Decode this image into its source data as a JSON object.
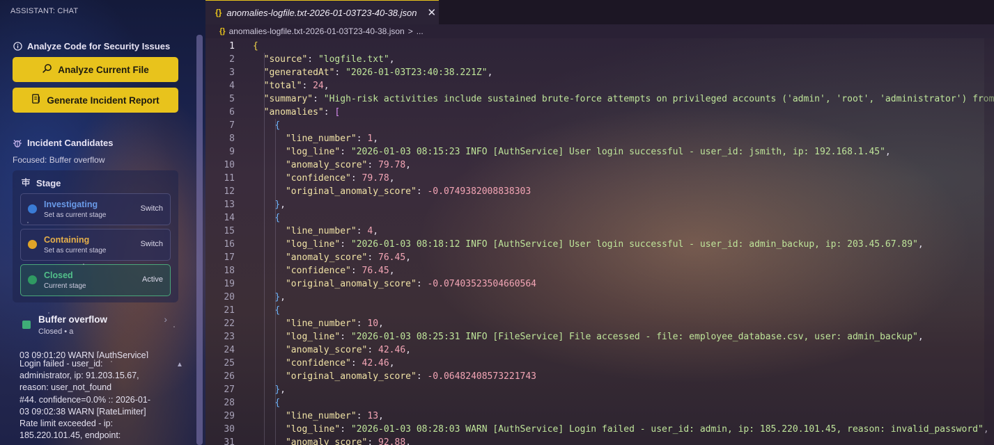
{
  "sidebar": {
    "title": "ASSISTANT: CHAT",
    "analyze_section": "Analyze Code for Security Issues",
    "analyze_button": "Analyze Current File",
    "report_button": "Generate Incident Report",
    "incident_section": "Incident Candidates",
    "focused": "Focused: Buffer overflow",
    "stage": {
      "title": "Stage",
      "cards": [
        {
          "name": "Investigating",
          "sub": "Set as current stage",
          "action": "Switch",
          "color": "#3a7bd5"
        },
        {
          "name": "Containing",
          "sub": "Set as current stage",
          "action": "Switch",
          "color": "#e0a428"
        },
        {
          "name": "Closed",
          "sub": "Current stage",
          "action": "Active",
          "color": "#2f9a62"
        }
      ]
    },
    "incident": {
      "name": "Buffer overflow",
      "meta": "Closed • a"
    },
    "log_partial": "03 09:01:20 WARN [AuthService]",
    "log_text": "Login failed - user_id:\nadministrator, ip: 91.203.15.67,\nreason: user_not_found\n#44. confidence=0.0% :: 2026-01-\n03 09:02:38 WARN [RateLimiter]\nRate limit exceeded - ip:\n185.220.101.45, endpoint:"
  },
  "editor": {
    "tab_icon": "{}",
    "tab_label": "anomalies-logfile.txt-2026-01-03T23-40-38.json",
    "close_glyph": "✕",
    "breadcrumb_file": "anomalies-logfile.txt-2026-01-03T23-40-38.json",
    "breadcrumb_sep": ">",
    "breadcrumb_more": "...",
    "current_line": 1,
    "lines": [
      [
        [
          "b",
          "{"
        ]
      ],
      [
        [
          "p",
          "  "
        ],
        [
          "k",
          "\"source\""
        ],
        [
          "p",
          ": "
        ],
        [
          "s",
          "\"logfile.txt\""
        ],
        [
          "p",
          ","
        ]
      ],
      [
        [
          "p",
          "  "
        ],
        [
          "k",
          "\"generatedAt\""
        ],
        [
          "p",
          ": "
        ],
        [
          "s",
          "\"2026-01-03T23:40:38.221Z\""
        ],
        [
          "p",
          ","
        ]
      ],
      [
        [
          "p",
          "  "
        ],
        [
          "k",
          "\"total\""
        ],
        [
          "p",
          ": "
        ],
        [
          "n",
          "24"
        ],
        [
          "p",
          ","
        ]
      ],
      [
        [
          "p",
          "  "
        ],
        [
          "k",
          "\"summary\""
        ],
        [
          "p",
          ": "
        ],
        [
          "s",
          "\"High-risk activities include sustained brute-force attempts on privileged accounts ('admin', 'root', 'administrator') from mu"
        ]
      ],
      [
        [
          "p",
          "  "
        ],
        [
          "k",
          "\"anomalies\""
        ],
        [
          "p",
          ": "
        ],
        [
          "b2",
          "["
        ]
      ],
      [
        [
          "p",
          "    "
        ],
        [
          "b3",
          "{"
        ]
      ],
      [
        [
          "p",
          "      "
        ],
        [
          "k",
          "\"line_number\""
        ],
        [
          "p",
          ": "
        ],
        [
          "n",
          "1"
        ],
        [
          "p",
          ","
        ]
      ],
      [
        [
          "p",
          "      "
        ],
        [
          "k",
          "\"log_line\""
        ],
        [
          "p",
          ": "
        ],
        [
          "s",
          "\"2026-01-03 08:15:23 INFO [AuthService] User login successful - user_id: jsmith, ip: 192.168.1.45\""
        ],
        [
          "p",
          ","
        ]
      ],
      [
        [
          "p",
          "      "
        ],
        [
          "k",
          "\"anomaly_score\""
        ],
        [
          "p",
          ": "
        ],
        [
          "n",
          "79.78"
        ],
        [
          "p",
          ","
        ]
      ],
      [
        [
          "p",
          "      "
        ],
        [
          "k",
          "\"confidence\""
        ],
        [
          "p",
          ": "
        ],
        [
          "n",
          "79.78"
        ],
        [
          "p",
          ","
        ]
      ],
      [
        [
          "p",
          "      "
        ],
        [
          "k",
          "\"original_anomaly_score\""
        ],
        [
          "p",
          ": "
        ],
        [
          "n",
          "-0.0749382008838303"
        ]
      ],
      [
        [
          "p",
          "    "
        ],
        [
          "b3",
          "}"
        ],
        [
          "p",
          ","
        ]
      ],
      [
        [
          "p",
          "    "
        ],
        [
          "b3",
          "{"
        ]
      ],
      [
        [
          "p",
          "      "
        ],
        [
          "k",
          "\"line_number\""
        ],
        [
          "p",
          ": "
        ],
        [
          "n",
          "4"
        ],
        [
          "p",
          ","
        ]
      ],
      [
        [
          "p",
          "      "
        ],
        [
          "k",
          "\"log_line\""
        ],
        [
          "p",
          ": "
        ],
        [
          "s",
          "\"2026-01-03 08:18:12 INFO [AuthService] User login successful - user_id: admin_backup, ip: 203.45.67.89\""
        ],
        [
          "p",
          ","
        ]
      ],
      [
        [
          "p",
          "      "
        ],
        [
          "k",
          "\"anomaly_score\""
        ],
        [
          "p",
          ": "
        ],
        [
          "n",
          "76.45"
        ],
        [
          "p",
          ","
        ]
      ],
      [
        [
          "p",
          "      "
        ],
        [
          "k",
          "\"confidence\""
        ],
        [
          "p",
          ": "
        ],
        [
          "n",
          "76.45"
        ],
        [
          "p",
          ","
        ]
      ],
      [
        [
          "p",
          "      "
        ],
        [
          "k",
          "\"original_anomaly_score\""
        ],
        [
          "p",
          ": "
        ],
        [
          "n",
          "-0.07403523504660564"
        ]
      ],
      [
        [
          "p",
          "    "
        ],
        [
          "b3",
          "}"
        ],
        [
          "p",
          ","
        ]
      ],
      [
        [
          "p",
          "    "
        ],
        [
          "b3",
          "{"
        ]
      ],
      [
        [
          "p",
          "      "
        ],
        [
          "k",
          "\"line_number\""
        ],
        [
          "p",
          ": "
        ],
        [
          "n",
          "10"
        ],
        [
          "p",
          ","
        ]
      ],
      [
        [
          "p",
          "      "
        ],
        [
          "k",
          "\"log_line\""
        ],
        [
          "p",
          ": "
        ],
        [
          "s",
          "\"2026-01-03 08:25:31 INFO [FileService] File accessed - file: employee_database.csv, user: admin_backup\""
        ],
        [
          "p",
          ","
        ]
      ],
      [
        [
          "p",
          "      "
        ],
        [
          "k",
          "\"anomaly_score\""
        ],
        [
          "p",
          ": "
        ],
        [
          "n",
          "42.46"
        ],
        [
          "p",
          ","
        ]
      ],
      [
        [
          "p",
          "      "
        ],
        [
          "k",
          "\"confidence\""
        ],
        [
          "p",
          ": "
        ],
        [
          "n",
          "42.46"
        ],
        [
          "p",
          ","
        ]
      ],
      [
        [
          "p",
          "      "
        ],
        [
          "k",
          "\"original_anomaly_score\""
        ],
        [
          "p",
          ": "
        ],
        [
          "n",
          "-0.06482408573221743"
        ]
      ],
      [
        [
          "p",
          "    "
        ],
        [
          "b3",
          "}"
        ],
        [
          "p",
          ","
        ]
      ],
      [
        [
          "p",
          "    "
        ],
        [
          "b3",
          "{"
        ]
      ],
      [
        [
          "p",
          "      "
        ],
        [
          "k",
          "\"line_number\""
        ],
        [
          "p",
          ": "
        ],
        [
          "n",
          "13"
        ],
        [
          "p",
          ","
        ]
      ],
      [
        [
          "p",
          "      "
        ],
        [
          "k",
          "\"log_line\""
        ],
        [
          "p",
          ": "
        ],
        [
          "s",
          "\"2026-01-03 08:28:03 WARN [AuthService] Login failed - user_id: admin, ip: 185.220.101.45, reason: invalid_password\""
        ],
        [
          "p",
          ","
        ]
      ],
      [
        [
          "p",
          "      "
        ],
        [
          "k",
          "\"anomaly_score\""
        ],
        [
          "p",
          ": "
        ],
        [
          "n",
          "92.88"
        ],
        [
          "p",
          ","
        ]
      ]
    ]
  }
}
